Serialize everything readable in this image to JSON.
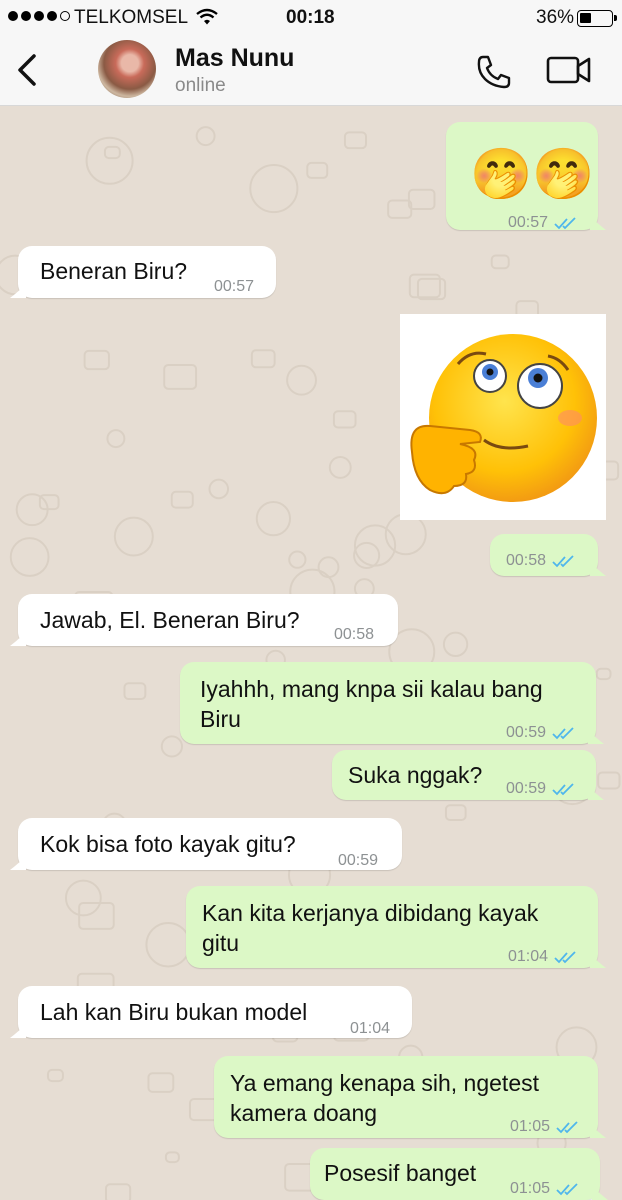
{
  "status_bar": {
    "carrier": "TELKOMSEL",
    "time": "00:18",
    "battery": "36%",
    "battery_level": 0.36,
    "signal_dots_filled": 4,
    "signal_dots_total": 5
  },
  "header": {
    "contact_name": "Mas Nunu",
    "contact_status": "online"
  },
  "icons": {
    "back": "chevron-left-icon",
    "call": "phone-icon",
    "video": "video-camera-icon",
    "read_receipt": "double-check-icon",
    "scroll": "chevron-down-icon"
  },
  "colors": {
    "incoming_bubble": "#ffffff",
    "outgoing_bubble": "#dcf8c6",
    "read_tick": "#4fb6ec",
    "chat_background": "#e6ddd3"
  },
  "messages": [
    {
      "dir": "out",
      "kind": "emoji",
      "text": "🤭🤭",
      "time": "00:57",
      "read": true
    },
    {
      "dir": "in",
      "kind": "text",
      "text": "Beneran Biru?",
      "time": "00:57"
    },
    {
      "dir": "out",
      "kind": "sticker",
      "sticker": "shy-thinking-emoji-sticker"
    },
    {
      "dir": "out",
      "kind": "time-only",
      "time": "00:58",
      "read": true
    },
    {
      "dir": "in",
      "kind": "text",
      "text": "Jawab, El. Beneran Biru?",
      "time": "00:58"
    },
    {
      "dir": "out",
      "kind": "text",
      "text": "Iyahhh, mang knpa sii kalau bang\nBiru",
      "time": "00:59",
      "read": true
    },
    {
      "dir": "out",
      "kind": "text",
      "text": "Suka nggak?",
      "time": "00:59",
      "read": true
    },
    {
      "dir": "in",
      "kind": "text",
      "text": "Kok bisa foto kayak gitu?",
      "time": "00:59"
    },
    {
      "dir": "out",
      "kind": "text",
      "text": "Kan kita kerjanya dibidang kayak\ngitu",
      "time": "01:04",
      "read": true
    },
    {
      "dir": "in",
      "kind": "text",
      "text": "Lah kan Biru bukan model",
      "time": "01:04"
    },
    {
      "dir": "out",
      "kind": "text",
      "text": "Ya emang kenapa sih, ngetest\nkamera doang",
      "time": "01:05",
      "read": true
    },
    {
      "dir": "out",
      "kind": "text",
      "text": "Posesif banget",
      "time": "01:05",
      "read": true
    }
  ]
}
